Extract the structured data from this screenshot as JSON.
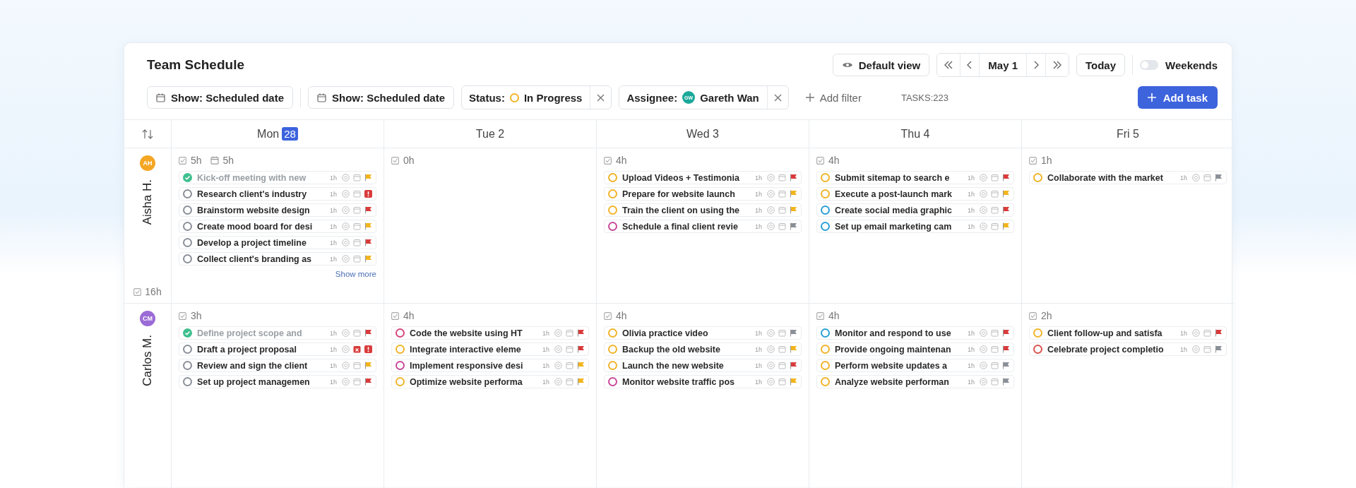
{
  "title": "Team Schedule",
  "view_button": "Default view",
  "nav": {
    "date": "May 1"
  },
  "today_button": "Today",
  "weekends": {
    "label": "Weekends",
    "on": false
  },
  "filters": [
    {
      "kind": "date",
      "label": "Show: Scheduled date"
    },
    {
      "kind": "date",
      "label": "Show: Scheduled date"
    },
    {
      "kind": "status",
      "key": "Status:",
      "value": "In Progress",
      "color": "#f0b429"
    },
    {
      "kind": "assignee",
      "key": "Assignee:",
      "initials": "GW",
      "value": "Gareth Wan",
      "color": "#1aa89a"
    }
  ],
  "add_filter": "Add filter",
  "task_count": "TASKS:223",
  "add_task": "Add task",
  "days": [
    {
      "label": "Mon",
      "badge": "28"
    },
    {
      "label": "Tue 2"
    },
    {
      "label": "Wed 3"
    },
    {
      "label": "Thu 4"
    },
    {
      "label": "Fri 5"
    }
  ],
  "people": [
    {
      "initials": "AH",
      "name": "Aisha H.",
      "color": "#f5a623",
      "total": "16h",
      "days": [
        {
          "hours": "5h",
          "scheduled": "5h",
          "show_more": "Show more",
          "tasks": [
            {
              "title": "Kick-off meeting with new",
              "estimate": "1h",
              "color": "#3fbf8f",
              "done": true,
              "overdue": false,
              "kind": "normal"
            },
            {
              "title": "Research client's industry",
              "estimate": "1h",
              "color": "#8a8f98",
              "done": false,
              "overdue": false,
              "kind": "urgent"
            },
            {
              "title": "Brainstorm website design",
              "estimate": "1h",
              "color": "#8a8f98",
              "done": false,
              "overdue": false,
              "kind": "high"
            },
            {
              "title": "Create mood board for desi",
              "estimate": "1h",
              "color": "#8a8f98",
              "done": false,
              "overdue": false,
              "kind": "normal"
            },
            {
              "title": "Develop a project timeline",
              "estimate": "1h",
              "color": "#8a8f98",
              "done": false,
              "overdue": false,
              "kind": "high"
            },
            {
              "title": "Collect client's branding as",
              "estimate": "1h",
              "color": "#8a8f98",
              "done": false,
              "overdue": false,
              "kind": "normal"
            }
          ]
        },
        {
          "hours": "0h"
        },
        {
          "hours": "4h",
          "tasks": [
            {
              "title": "Upload Videos + Testimonia",
              "estimate": "1h",
              "color": "#f0b429",
              "done": false,
              "overdue": false,
              "kind": "high"
            },
            {
              "title": "Prepare for website launch",
              "estimate": "1h",
              "color": "#f0b429",
              "done": false,
              "overdue": false,
              "kind": "normal"
            },
            {
              "title": "Train the client on using the",
              "estimate": "1h",
              "color": "#f0b429",
              "done": false,
              "overdue": false,
              "kind": "normal"
            },
            {
              "title": "Schedule a final client revie",
              "estimate": "1h",
              "color": "#c9489b",
              "done": false,
              "overdue": false,
              "kind": "low"
            }
          ]
        },
        {
          "hours": "4h",
          "tasks": [
            {
              "title": "Submit sitemap to search e",
              "estimate": "1h",
              "color": "#f0b429",
              "done": false,
              "overdue": false,
              "kind": "high"
            },
            {
              "title": "Execute a post-launch mark",
              "estimate": "1h",
              "color": "#f0b429",
              "done": false,
              "overdue": false,
              "kind": "normal"
            },
            {
              "title": "Create social media graphic",
              "estimate": "1h",
              "color": "#2a9fd6",
              "done": false,
              "overdue": false,
              "kind": "high"
            },
            {
              "title": "Set up email marketing cam",
              "estimate": "1h",
              "color": "#2a9fd6",
              "done": false,
              "overdue": false,
              "kind": "normal"
            }
          ]
        },
        {
          "hours": "1h",
          "tasks": [
            {
              "title": "Collaborate with the market",
              "estimate": "1h",
              "color": "#f0b429",
              "done": false,
              "overdue": false,
              "kind": "low"
            }
          ]
        }
      ]
    },
    {
      "initials": "CM",
      "name": "Carlos M.",
      "color": "#9b6bd6",
      "days": [
        {
          "hours": "3h",
          "tasks": [
            {
              "title": "Define project scope and",
              "estimate": "1h",
              "color": "#3fbf8f",
              "done": true,
              "overdue": false,
              "kind": "high"
            },
            {
              "title": "Draft a project proposal",
              "estimate": "1h",
              "color": "#8a8f98",
              "done": false,
              "overdue": true,
              "kind": "urgent"
            },
            {
              "title": "Review and sign the client",
              "estimate": "1h",
              "color": "#8a8f98",
              "done": false,
              "overdue": false,
              "kind": "normal"
            },
            {
              "title": "Set up project managemen",
              "estimate": "1h",
              "color": "#8a8f98",
              "done": false,
              "overdue": false,
              "kind": "high"
            }
          ]
        },
        {
          "hours": "4h",
          "tasks": [
            {
              "title": "Code the website using HT",
              "estimate": "1h",
              "color": "#d6457a",
              "done": false,
              "overdue": false,
              "kind": "high"
            },
            {
              "title": "Integrate interactive eleme",
              "estimate": "1h",
              "color": "#f0b429",
              "done": false,
              "overdue": false,
              "kind": "high"
            },
            {
              "title": "Implement responsive desi",
              "estimate": "1h",
              "color": "#c9489b",
              "done": false,
              "overdue": false,
              "kind": "normal"
            },
            {
              "title": "Optimize website performa",
              "estimate": "1h",
              "color": "#f0b429",
              "done": false,
              "overdue": false,
              "kind": "normal"
            }
          ]
        },
        {
          "hours": "4h",
          "tasks": [
            {
              "title": "Olivia practice video",
              "estimate": "1h",
              "color": "#f0b429",
              "done": false,
              "overdue": false,
              "kind": "low"
            },
            {
              "title": "Backup the old website",
              "estimate": "1h",
              "color": "#f0b429",
              "done": false,
              "overdue": false,
              "kind": "normal"
            },
            {
              "title": "Launch the new website",
              "estimate": "1h",
              "color": "#f0b429",
              "done": false,
              "overdue": false,
              "kind": "high"
            },
            {
              "title": "Monitor website traffic pos",
              "estimate": "1h",
              "color": "#c9489b",
              "done": false,
              "overdue": false,
              "kind": "normal"
            }
          ]
        },
        {
          "hours": "4h",
          "tasks": [
            {
              "title": "Monitor and respond to use",
              "estimate": "1h",
              "color": "#2a9fd6",
              "done": false,
              "overdue": false,
              "kind": "high"
            },
            {
              "title": "Provide ongoing maintenan",
              "estimate": "1h",
              "color": "#f0b429",
              "done": false,
              "overdue": false,
              "kind": "high"
            },
            {
              "title": "Perform website updates a",
              "estimate": "1h",
              "color": "#f0b429",
              "done": false,
              "overdue": false,
              "kind": "low"
            },
            {
              "title": "Analyze website performan",
              "estimate": "1h",
              "color": "#f0b429",
              "done": false,
              "overdue": false,
              "kind": "low"
            }
          ]
        },
        {
          "hours": "2h",
          "tasks": [
            {
              "title": "Client follow-up and satisfa",
              "estimate": "1h",
              "color": "#f0b429",
              "done": false,
              "overdue": false,
              "kind": "high"
            },
            {
              "title": "Celebrate project completio",
              "estimate": "1h",
              "color": "#d9534f",
              "done": false,
              "overdue": false,
              "kind": "low"
            }
          ]
        }
      ]
    }
  ]
}
